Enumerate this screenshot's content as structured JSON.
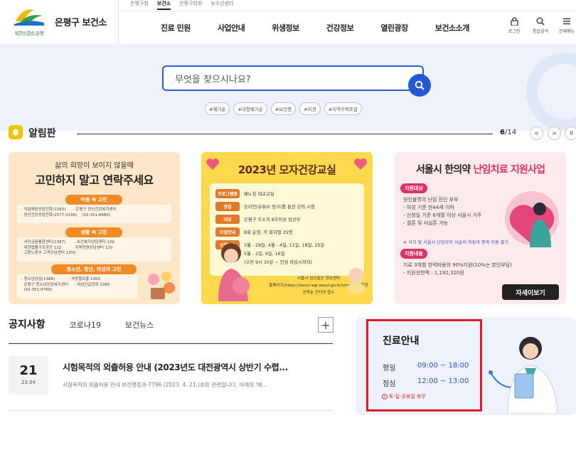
{
  "header": {
    "brand": "은평구 보건소",
    "logo_sub": "복한신결승,은평",
    "topbar": [
      "은평구청",
      "보건소",
      "은평구의회",
      "농수산센터"
    ],
    "topbar_active": 1,
    "nav": [
      "진료 민원",
      "사업안내",
      "위생정보",
      "건강정보",
      "열린광장",
      "보건소소개"
    ],
    "utils": [
      {
        "icon": "lock-icon",
        "label": "로그인"
      },
      {
        "icon": "search-icon",
        "label": "통합검색"
      },
      {
        "icon": "menu-icon",
        "label": "전체메뉴"
      }
    ]
  },
  "search": {
    "placeholder": "무엇을 찾으시나요?",
    "tags": [
      "#예기운",
      "#대형폐기운",
      "#보건증",
      "#미견",
      "#지역주택조합"
    ]
  },
  "board": {
    "title": "알림판",
    "page_current": "6",
    "page_total": "/14",
    "prev": "<",
    "next": ">",
    "pause": "II"
  },
  "banners": {
    "b1": {
      "line1": "삶의 희망이 보이지 않을때",
      "line2": "고민하지 말고 연락주세요",
      "sec1": "마음 속 고민",
      "sec1_text": "· 자살예방상담전화(1393)      · 은평구 정신건강복지센터\n· 정신건강상담전화(1577-0199)    (02-351-8680)",
      "sec2": "생활 속 고민",
      "sec2_text": "· 서민금융통합센터(1397)       · 보건복지상담센터 129\n· 대한법률구조공단 132         · 지역민원상담센터 120\n· 고용노동부 고객상담센터 1350",
      "sec3": "청소년, 청년, 여성의 고민",
      "sec3_text": "· 청소년상담(1388)           · 국방헬프콜 1303\n· 은평구 청소년상담복지센터     · 여성긴급전화 1366\n  (02-351-8760)"
    },
    "b2": {
      "title": "2023년 모자건강교실",
      "rows": [
        {
          "label": "프로그램명",
          "text": "베노칭 태교교실"
        },
        {
          "label": "방법",
          "text": "온라인(유튜브 링크)를 통한 강의 시청"
        },
        {
          "label": "대상",
          "text": "은평구 주소지 8주이상 임산부"
        },
        {
          "label": "모집안내",
          "text": "8회 운영, 각 회차별 35명"
        },
        {
          "label": "신청일자",
          "text": "3월 - 28일, 4월 - 4일, 11일, 18일, 25일"
        }
      ],
      "extra1": "5월 - 2일, 9일, 16일",
      "extra2": "(오전 9시 30분 ~ 인원 마감시까지)",
      "foot1": "서울시 임신출산 정보센터",
      "foot2": "홈페이지(https://seoul-agi.seoul.go.kr/smom)를 통한",
      "foot3": "선착순 인터넷 접수"
    },
    "b3": {
      "title_a": "서울시 한의약 ",
      "title_b": "난임치료 지원사업",
      "pill1": "지원대상",
      "list1": "원인불명의 난임 진단 부부\n- 여성 기준 만44세 이하\n- 신청일 기준 6개월 이상 서울시 거주\n- 결혼 및 사실혼 가능",
      "note": "※ 국가 및 서울시 난임부부 시술비 지원과 중복 지원 불가",
      "pill2": "지원내용",
      "list2": "치료 3개월 한약비용의 90%지원(10%는 본인부담)\n- 지원상한액 : 1,192,320원",
      "more": "자세이보기"
    }
  },
  "notices": {
    "tabs": [
      "공지사항",
      "코로나19",
      "보건뉴스"
    ],
    "more": "+",
    "item": {
      "day": "21",
      "ym": "23.04",
      "title": "시험목적의 외출허용 안내 (2023년도 대전광역시 상반기 수렵...",
      "desc": "시험목적의 외출허용 안내 보건행정과-7796 (2023. 4. 21.)호와 관련입니다. 아래의 '혜..."
    }
  },
  "clinic": {
    "title": "진료안내",
    "weekday_label": "평일",
    "weekday_time": "09:00 ~ 18:00",
    "lunch_label": "점심",
    "lunch_time": "12:00 ~ 13:00",
    "note": "토·일·공휴일 휴무"
  },
  "colors": {
    "accent": "#2558d4",
    "clinic_border": "#e01b2f",
    "time_blue": "#2b57cc",
    "hero_bg": "#eef3fb"
  }
}
